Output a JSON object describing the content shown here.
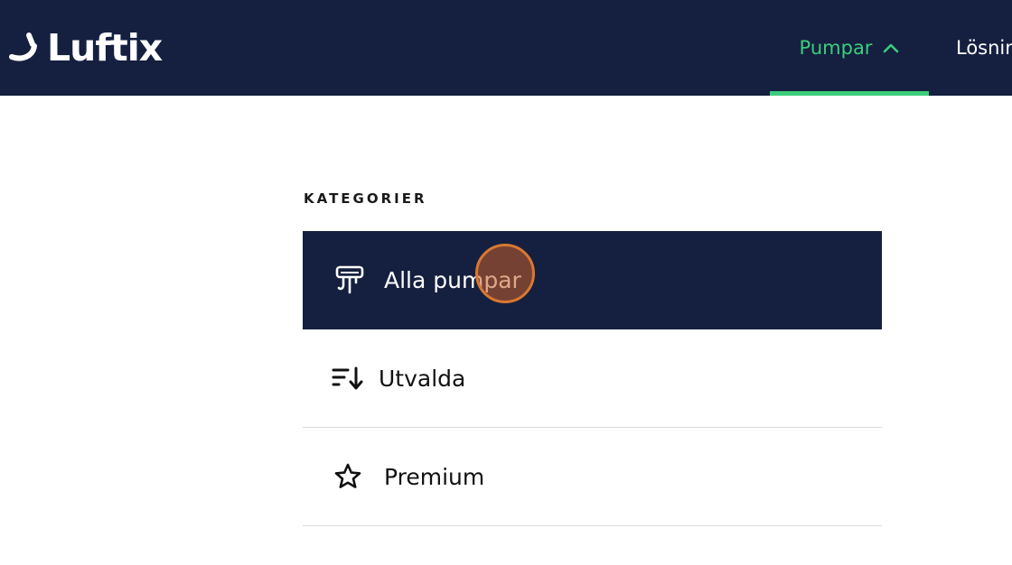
{
  "header": {
    "logo_text": "Luftix",
    "nav": [
      {
        "label": "Pumpar",
        "active": true,
        "icon": "chevron-up-icon"
      },
      {
        "label": "Lösning"
      }
    ]
  },
  "main": {
    "section_heading": "KATEGORIER",
    "categories": [
      {
        "label": "Alla pumpar",
        "icon": "pump-icon",
        "active": true
      },
      {
        "label": "Utvalda",
        "icon": "sort-descending-icon"
      },
      {
        "label": "Premium",
        "icon": "star-icon"
      }
    ]
  },
  "colors": {
    "navy": "#152040",
    "accent_green": "#3ccd7a",
    "click_marker": "#d97830"
  }
}
